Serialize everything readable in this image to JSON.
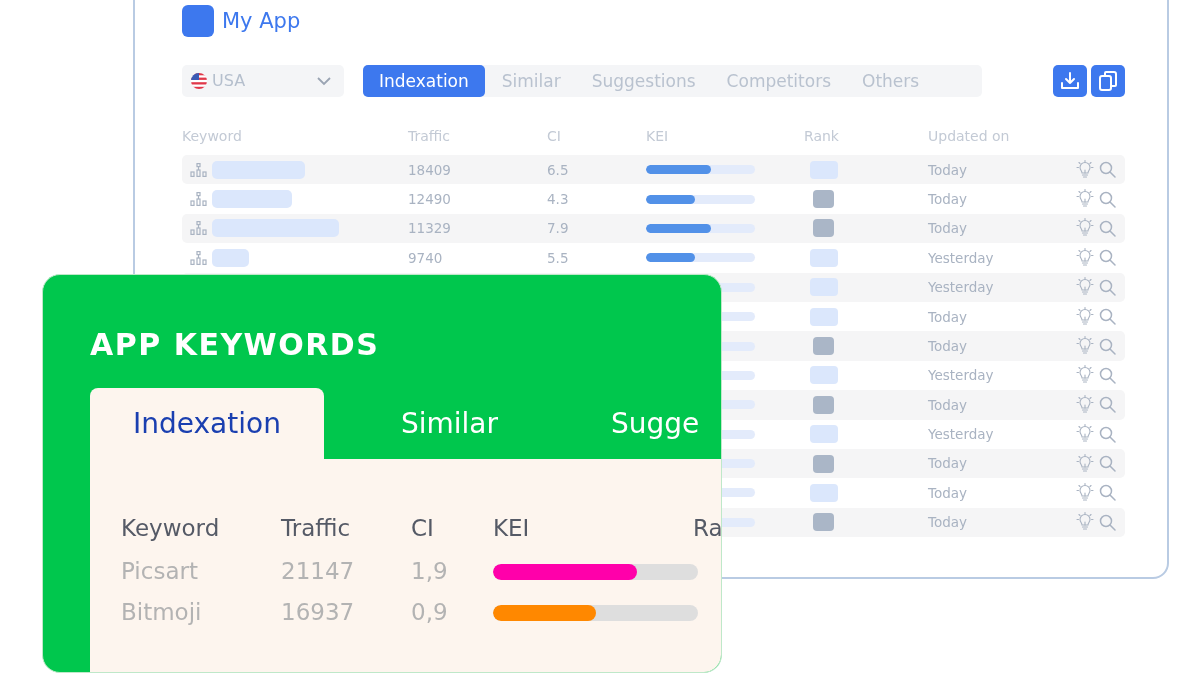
{
  "window": {
    "app_name": "My App",
    "country": {
      "value": "USA"
    },
    "tabs": [
      {
        "label": "Indexation",
        "selected": true
      },
      {
        "label": "Similar",
        "selected": false
      },
      {
        "label": "Suggestions",
        "selected": false
      },
      {
        "label": "Competitors",
        "selected": false
      },
      {
        "label": "Others",
        "selected": false
      }
    ],
    "table": {
      "columns": [
        "Keyword",
        "Traffic",
        "CI",
        "KEI",
        "Rank",
        "Updated on"
      ],
      "rows": [
        {
          "traffic": "18409",
          "ci": "6.5",
          "kei": {
            "level": 0.6
          },
          "rank_filled": false,
          "updated": "Today"
        },
        {
          "traffic": "12490",
          "ci": "4.3",
          "kei": {
            "level": 0.45
          },
          "rank_filled": true,
          "updated": "Today"
        },
        {
          "traffic": "11329",
          "ci": "7.9",
          "kei": {
            "level": 0.6
          },
          "rank_filled": true,
          "updated": "Today"
        },
        {
          "traffic": "9740",
          "ci": "5.5",
          "kei": {
            "level": 0.45
          },
          "rank_filled": false,
          "updated": "Yesterday"
        },
        {
          "rank_filled": false,
          "updated": "Yesterday"
        },
        {
          "rank_filled": false,
          "updated": "Today"
        },
        {
          "rank_filled": true,
          "updated": "Today"
        },
        {
          "rank_filled": false,
          "updated": "Yesterday"
        },
        {
          "rank_filled": true,
          "updated": "Today"
        },
        {
          "rank_filled": false,
          "updated": "Yesterday"
        },
        {
          "rank_filled": true,
          "updated": "Today"
        },
        {
          "rank_filled": false,
          "updated": "Today"
        },
        {
          "rank_filled": true,
          "updated": "Today"
        }
      ]
    }
  },
  "card": {
    "title": "APP KEYWORDS",
    "tabs": [
      {
        "label": "Indexation",
        "selected": true
      },
      {
        "label": "Similar",
        "selected": false
      },
      {
        "label": "Sugge",
        "selected": false
      }
    ],
    "table": {
      "columns": [
        "Keyword",
        "Traffic",
        "CI",
        "KEI",
        "Ra"
      ],
      "rows": [
        {
          "keyword": "Picsart",
          "traffic": "21147",
          "ci": "1,9",
          "kei": {
            "level": 0.7,
            "color": "#ff00aa"
          }
        },
        {
          "keyword": "Bitmoji",
          "traffic": "16937",
          "ci": "0,9",
          "kei": {
            "level": 0.5,
            "color": "#ff8800"
          }
        }
      ]
    }
  }
}
